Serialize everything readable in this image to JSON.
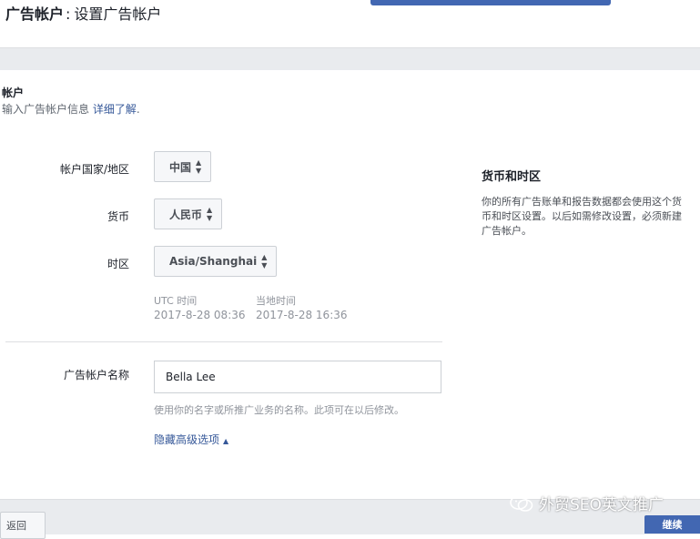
{
  "header": {
    "title_strong": "广告帐户",
    "title_sep": ":",
    "title_rest": "设置广告帐户"
  },
  "section": {
    "title": "帐户",
    "subtitle": "输入广告帐户信息",
    "learn_more": "详细了解",
    "period": "."
  },
  "form": {
    "country": {
      "label": "帐户国家/地区",
      "value": "中国"
    },
    "currency": {
      "label": "货币",
      "value": "人民币"
    },
    "timezone": {
      "label": "时区",
      "value": "Asia/Shanghai"
    },
    "utc": {
      "label": "UTC 时间",
      "value": "2017-8-28 08:36"
    },
    "local": {
      "label": "当地时间",
      "value": "2017-8-28 16:36"
    },
    "account_name": {
      "label": "广告帐户名称",
      "value": "Bella Lee",
      "hint": "使用你的名字或所推广业务的名称。此项可在以后修改。"
    },
    "advanced_toggle": "隐藏高级选项"
  },
  "sidebar": {
    "title": "货币和时区",
    "body": "你的所有广告账单和报告数据都会使用这个货币和时区设置。以后如需修改设置，必须新建广告帐户。"
  },
  "footer": {
    "back": "返回",
    "continue": "继续"
  },
  "watermark": "外贸SEO英文推广",
  "icons": {
    "select_caret": "sort-caret-icon",
    "advanced_caret": "caret-up-icon",
    "watermark": "wechat-icon"
  },
  "colors": {
    "accent": "#4267b2",
    "link": "#365899",
    "band": "#e9ebee"
  }
}
